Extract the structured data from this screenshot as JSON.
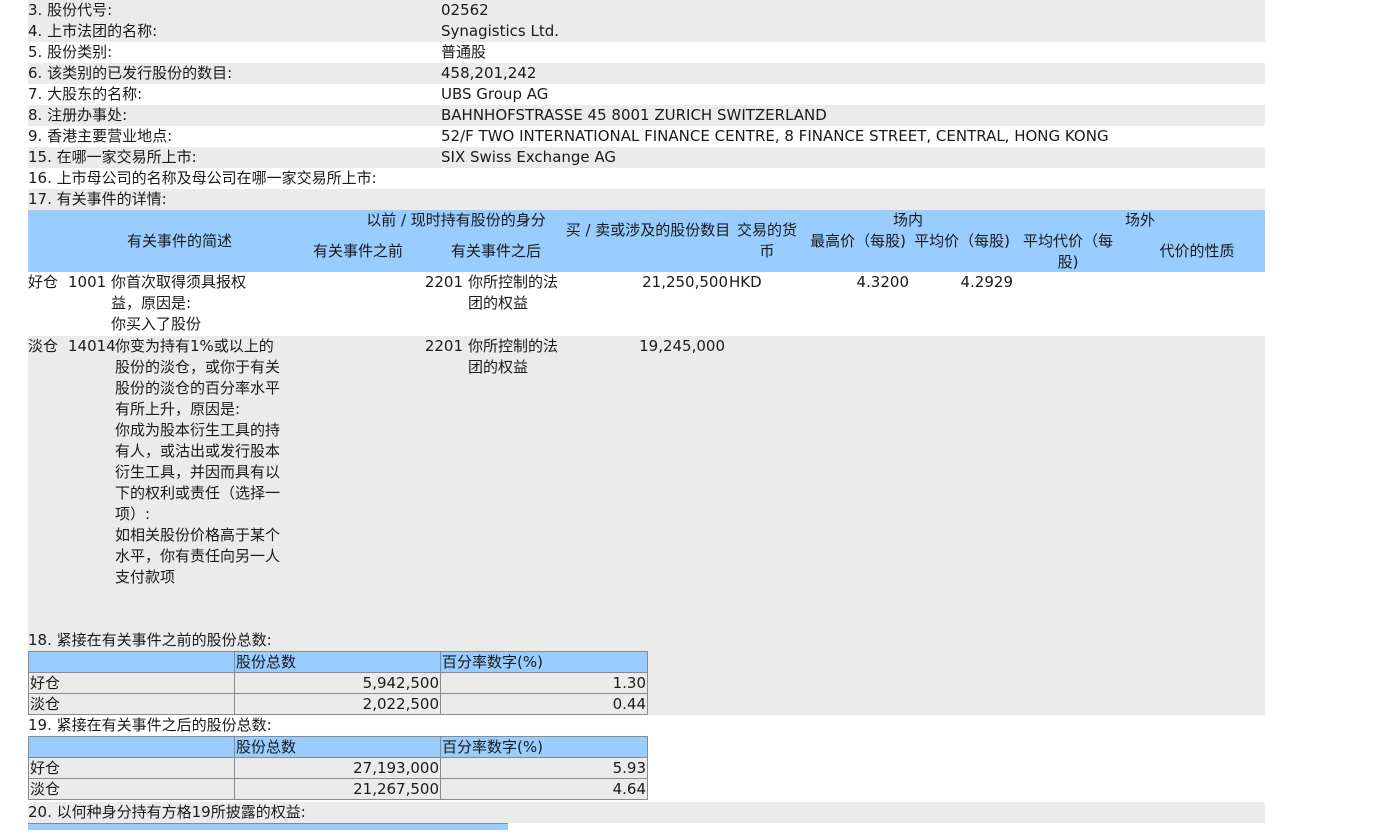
{
  "fields": [
    {
      "label": "3. 股份代号:",
      "value": "02562"
    },
    {
      "label": "4. 上市法团的名称:",
      "value": "Synagistics Ltd."
    },
    {
      "label": "5. 股份类别:",
      "value": "普通股"
    },
    {
      "label": "6. 该类别的已发行股份的数目:",
      "value": "458,201,242"
    },
    {
      "label": "7. 大股东的名称:",
      "value": "UBS Group AG"
    },
    {
      "label": "8. 注册办事处:",
      "value": "BAHNHOFSTRASSE 45 8001 ZURICH SWITZERLAND"
    },
    {
      "label": "9. 香港主要营业地点:",
      "value": "52/F TWO INTERNATIONAL FINANCE CENTRE, 8 FINANCE STREET, CENTRAL, HONG KONG"
    },
    {
      "label": "15. 在哪一家交易所上市:",
      "value": "SIX Swiss Exchange AG"
    },
    {
      "label": "16. 上市母公司的名称及母公司在哪一家交易所上市:",
      "value": ""
    },
    {
      "label": "17. 有关事件的详情:",
      "value": ""
    }
  ],
  "event_table": {
    "headers": {
      "desc": "有关事件的简述",
      "capacity_group": "以前 / 现时持有股份的身分",
      "before": "有关事件之前",
      "after": "有关事件之后",
      "shares": "买 / 卖或涉及的股份数目",
      "currency": "交易的货币",
      "onexch_group": "场内",
      "high": "最高价（每股)",
      "avg": "平均价（每股)",
      "offexch_group": "场外",
      "avg_off": "平均代价（每股)",
      "nature": "代价的性质"
    },
    "rows": [
      {
        "position": "好仓",
        "code": "1001",
        "description": "你首次取得须具报权益，原因是:\n你买入了股份",
        "before_code": "",
        "after_code": "2201",
        "after_desc": "你所控制的法团的权益",
        "shares": "21,250,500",
        "currency": "HKD",
        "high": "4.3200",
        "avg": "4.2929",
        "avg_off": "",
        "nature": ""
      },
      {
        "position": "淡仓",
        "code": "14014",
        "description": "你变为持有1%或以上的股份的淡仓，或你于有关股份的淡仓的百分率水平有所上升，原因是:\n你成为股本衍生工具的持有人，或沽出或发行股本衍生工具，并因而具有以下的权利或责任（选择一项）:\n如相关股份价格高于某个水平，你有责任向另一人支付款项",
        "before_code": "",
        "after_code": "2201",
        "after_desc": "你所控制的法团的权益",
        "shares": "19,245,000",
        "currency": "",
        "high": "",
        "avg": "",
        "avg_off": "",
        "nature": ""
      }
    ]
  },
  "sec18": {
    "title": "18. 紧接在有关事件之前的股份总数:",
    "col_total": "股份总数",
    "col_pct": "百分率数字(%)",
    "rows": [
      {
        "label": "好仓",
        "total": "5,942,500",
        "pct": "1.30"
      },
      {
        "label": "淡仓",
        "total": "2,022,500",
        "pct": "0.44"
      }
    ]
  },
  "sec19": {
    "title": "19. 紧接在有关事件之后的股份总数:",
    "col_total": "股份总数",
    "col_pct": "百分率数字(%)",
    "rows": [
      {
        "label": "好仓",
        "total": "27,193,000",
        "pct": "5.93"
      },
      {
        "label": "淡仓",
        "total": "21,267,500",
        "pct": "4.64"
      }
    ]
  },
  "sec20": {
    "title": "20. 以何种身分持有方格19所披露的权益:"
  }
}
